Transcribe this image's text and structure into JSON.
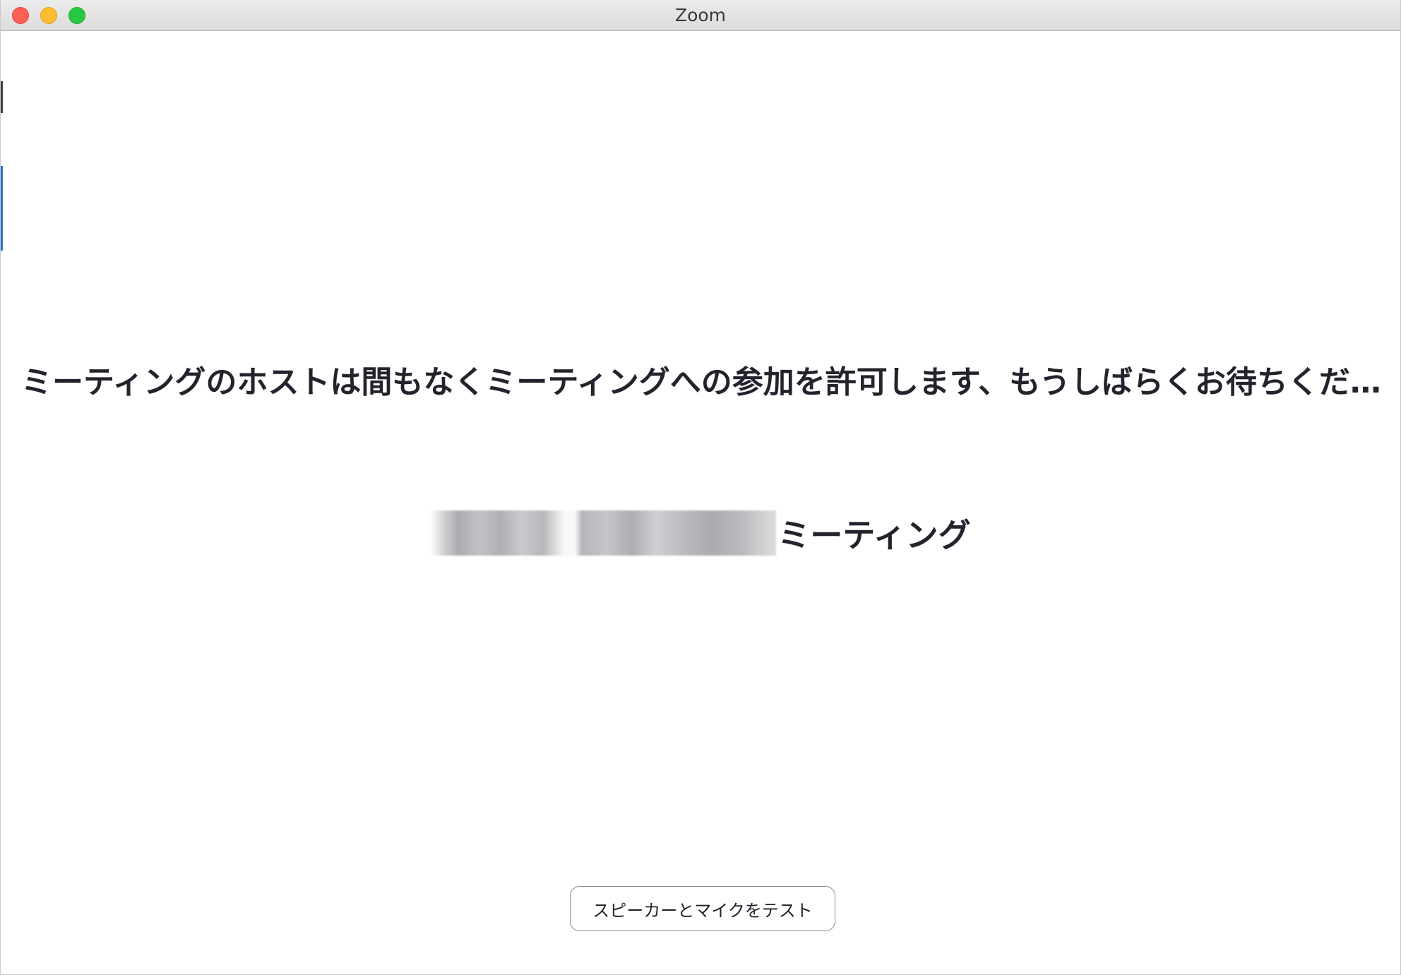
{
  "window": {
    "title": "Zoom"
  },
  "main": {
    "status_message": "ミーティングのホストは間もなくミーティングへの参加を許可します、もうしばらくお待ちくだ…",
    "meeting_name_suffix": "ミーティング",
    "test_button_label": "スピーカーとマイクをテスト"
  },
  "colors": {
    "text": "#23232d",
    "close": "#fe5f57",
    "minimize": "#febc2e",
    "maximize": "#28c840"
  }
}
